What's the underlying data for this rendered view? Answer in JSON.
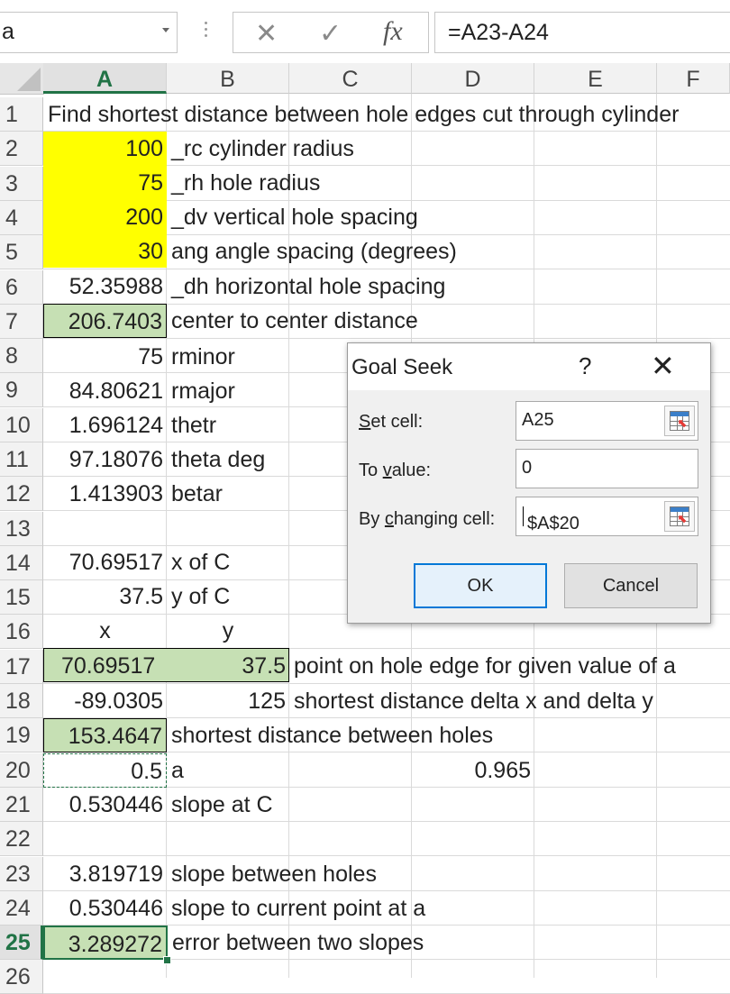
{
  "formula_bar": {
    "name_box": "a",
    "cancel_icon": "close-icon",
    "enter_icon": "check-icon",
    "fx_label": "fx",
    "formula": "=A23-A24"
  },
  "columns": [
    "A",
    "B",
    "C",
    "D",
    "E",
    "F"
  ],
  "rows": [
    "1",
    "2",
    "3",
    "4",
    "5",
    "6",
    "7",
    "8",
    "9",
    "10",
    "11",
    "12",
    "13",
    "14",
    "15",
    "16",
    "17",
    "18",
    "19",
    "20",
    "21",
    "22",
    "23",
    "24",
    "25",
    "26"
  ],
  "cells": {
    "B1": "Find shortest distance between hole edges cut through cylinder",
    "A2": "100",
    "B2": "_rc  cylinder radius",
    "A3": "75",
    "B3": "_rh  hole radius",
    "A4": "200",
    "B4": "_dv  vertical hole spacing",
    "A5": "30",
    "B5": "ang  angle spacing (degrees)",
    "A6": "52.35988",
    "B6": "_dh horizontal hole spacing",
    "A7": "206.7403",
    "B7": "center to center distance",
    "A8": "75",
    "B8": "rminor",
    "A9": "84.80621",
    "B9": "rmajor",
    "A10": "1.696124",
    "B10": "thetr",
    "A11": "97.18076",
    "B11": "theta deg",
    "A12": "1.413903",
    "B12": "betar",
    "A14": "70.69517",
    "B14": "x of C",
    "A15": "37.5",
    "B15": "y of C",
    "A16": "x",
    "B16": "y",
    "A17": "70.69517",
    "B17": "37.5",
    "C17": "point on hole edge for given value of a",
    "A18": "-89.0305",
    "B18": "125",
    "C18": "shortest distance  delta x  and delta y",
    "A19": "153.4647",
    "B19": "shortest distance between holes",
    "A20": "0.5",
    "B20": "a",
    "D20": "0.965",
    "A21": "0.530446",
    "B21": "slope at C",
    "A23": "3.819719",
    "B23": "slope between holes",
    "A24": "0.530446",
    "B24": "slope to current point at a",
    "A25": "3.289272",
    "B25": "error between two slopes"
  },
  "colors": {
    "input_fill": "#ffff00",
    "result_fill": "#c6e0b4",
    "selection": "#217346"
  },
  "goal_seek": {
    "title": "Goal Seek",
    "help": "?",
    "close_icon": "close-icon",
    "set_cell_label": "Set cell:",
    "set_cell_value": "A25",
    "to_value_label": "To value:",
    "to_value_value": "0",
    "changing_cell_label": "By changing cell:",
    "changing_cell_value": "$A$20",
    "ok_label": "OK",
    "cancel_label": "Cancel"
  }
}
